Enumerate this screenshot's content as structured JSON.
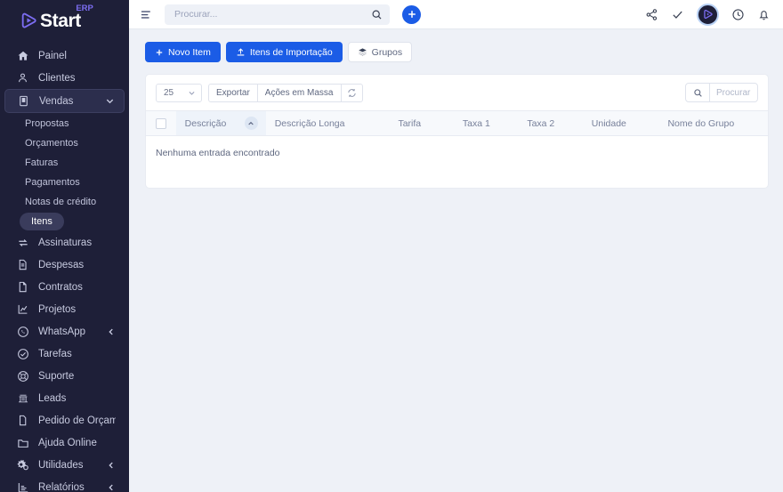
{
  "brand": {
    "name": "Start",
    "superscript": "ERP",
    "logo_icon": "play-circle-icon",
    "accent_purple": "#7c6df2",
    "sidebar_bg": "#1e1f38"
  },
  "sidebar": {
    "items": [
      {
        "label": "Painel",
        "icon": "home-icon",
        "type": "item",
        "active": false,
        "chevron": ""
      },
      {
        "label": "Clientes",
        "icon": "user-icon",
        "type": "item",
        "active": false,
        "chevron": ""
      },
      {
        "label": "Vendas",
        "icon": "book-icon",
        "type": "item",
        "active": true,
        "chevron": "down"
      },
      {
        "label": "Propostas",
        "icon": "",
        "type": "sub",
        "active": false,
        "chevron": ""
      },
      {
        "label": "Orçamentos",
        "icon": "",
        "type": "sub",
        "active": false,
        "chevron": ""
      },
      {
        "label": "Faturas",
        "icon": "",
        "type": "sub",
        "active": false,
        "chevron": ""
      },
      {
        "label": "Pagamentos",
        "icon": "",
        "type": "sub",
        "active": false,
        "chevron": ""
      },
      {
        "label": "Notas de crédito",
        "icon": "",
        "type": "sub",
        "active": false,
        "chevron": ""
      },
      {
        "label": "Itens",
        "icon": "",
        "type": "sub-pill",
        "active": true,
        "chevron": ""
      },
      {
        "label": "Assinaturas",
        "icon": "sync-icon",
        "type": "item",
        "active": false,
        "chevron": ""
      },
      {
        "label": "Despesas",
        "icon": "document-icon",
        "type": "item",
        "active": false,
        "chevron": ""
      },
      {
        "label": "Contratos",
        "icon": "document-text-icon",
        "type": "item",
        "active": false,
        "chevron": ""
      },
      {
        "label": "Projetos",
        "icon": "chart-icon",
        "type": "item",
        "active": false,
        "chevron": ""
      },
      {
        "label": "WhatsApp",
        "icon": "whatsapp-icon",
        "type": "item",
        "active": false,
        "chevron": "left"
      },
      {
        "label": "Tarefas",
        "icon": "check-circle-icon",
        "type": "item",
        "active": false,
        "chevron": ""
      },
      {
        "label": "Suporte",
        "icon": "lifebuoy-icon",
        "type": "item",
        "active": false,
        "chevron": ""
      },
      {
        "label": "Leads",
        "icon": "megaphone-icon",
        "type": "item",
        "active": false,
        "chevron": ""
      },
      {
        "label": "Pedido de Orçamento",
        "icon": "file-icon",
        "type": "item",
        "active": false,
        "chevron": ""
      },
      {
        "label": "Ajuda Online",
        "icon": "folder-icon",
        "type": "item",
        "active": false,
        "chevron": ""
      },
      {
        "label": "Utilidades",
        "icon": "gears-icon",
        "type": "item",
        "active": false,
        "chevron": "left"
      },
      {
        "label": "Relatórios",
        "icon": "bar-chart-icon",
        "type": "item",
        "active": false,
        "chevron": "left"
      }
    ]
  },
  "topbar": {
    "menu_icon": "hamburger-icon",
    "search_placeholder": "Procurar...",
    "search_value": "",
    "search_icon": "search-icon",
    "add_icon": "plus-icon",
    "share_icon": "share-icon",
    "check_icon": "check-icon",
    "avatar_icon": "user-avatar-logo",
    "clock_icon": "clock-icon",
    "bell_icon": "bell-icon"
  },
  "actions": {
    "new_item": "Novo Item",
    "new_item_icon": "plus-icon",
    "import_items": "Itens de Importação",
    "import_items_icon": "upload-icon",
    "groups": "Grupos",
    "groups_icon": "layers-icon"
  },
  "toolbar": {
    "page_size": "25",
    "page_size_icon": "chevron-down-icon",
    "export": "Exportar",
    "bulk_actions": "Ações em Massa",
    "refresh_icon": "refresh-icon",
    "search_icon": "search-icon",
    "search_placeholder": "Procurar",
    "search_value": ""
  },
  "table": {
    "columns": [
      "Descrição",
      "Descrição Longa",
      "Tarifa",
      "Taxa 1",
      "Taxa 2",
      "Unidade",
      "Nome do Grupo"
    ],
    "sorted_column": "Descrição",
    "sort_direction": "asc",
    "sort_icon": "chevron-up-icon",
    "select_all_checkbox": false,
    "rows": [],
    "empty_message": "Nenhuma entrada encontrado"
  },
  "colors": {
    "primary_blue": "#1b5ce6",
    "page_bg": "#eef1f7",
    "card_bg": "#ffffff"
  }
}
